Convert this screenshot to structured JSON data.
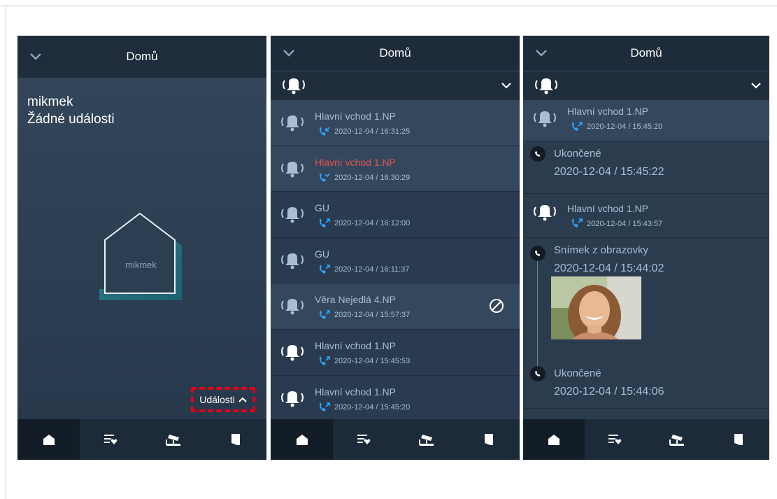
{
  "panels": {
    "home": {
      "title": "Domů",
      "account_name": "mikmek",
      "no_events": "Žádné události",
      "house_label": "mikmek",
      "events_button": "Události"
    },
    "events_list": {
      "title": "Domů",
      "items": [
        {
          "name": "Hlavní vchod 1.NP",
          "time": "2020-12-04 / 16:31:25",
          "call": "incoming",
          "missed": false,
          "blocked": false,
          "highlight": true
        },
        {
          "name": "Hlavní vchod 1.NP",
          "time": "2020-12-04 / 16:30:29",
          "call": "missed",
          "missed": true,
          "blocked": false,
          "highlight": true
        },
        {
          "name": "GU",
          "time": "2020-12-04 / 16:12:00",
          "call": "outgoing",
          "missed": false,
          "blocked": false,
          "highlight": false
        },
        {
          "name": "GU",
          "time": "2020-12-04 / 16:11:37",
          "call": "outgoing",
          "missed": false,
          "blocked": false,
          "highlight": false
        },
        {
          "name": "Věra Nejedlá 4.NP",
          "time": "2020-12-04 / 15:57:37",
          "call": "outgoing",
          "missed": false,
          "blocked": true,
          "highlight": true
        },
        {
          "name": "Hlavní vchod 1.NP",
          "time": "2020-12-04 / 15:45:53",
          "call": "outgoing",
          "missed": false,
          "blocked": false,
          "highlight": false
        },
        {
          "name": "Hlavní vchod 1.NP",
          "time": "2020-12-04 / 15:45:20",
          "call": "outgoing",
          "missed": false,
          "blocked": false,
          "highlight": false
        }
      ]
    },
    "event_detail": {
      "title": "Domů",
      "top_item": {
        "name": "Hlavní vchod 1.NP",
        "time": "2020-12-04 / 15:45:20"
      },
      "ended_1": {
        "label": "Ukončené",
        "time": "2020-12-04 / 15:45:22"
      },
      "second_item": {
        "name": "Hlavní vchod 1.NP",
        "time": "2020-12-04 / 15:43:57"
      },
      "snapshot": {
        "label": "Snímek z obrazovky",
        "time": "2020-12-04 / 15:44:02"
      },
      "ended_2": {
        "label": "Ukončené",
        "time": "2020-12-04 / 15:44:06"
      }
    }
  },
  "nav": {
    "items": [
      "home-icon",
      "list-heart-icon",
      "camera-icon",
      "door-icon"
    ],
    "active": 0
  },
  "colors": {
    "panel_bg": "#2c3c4f",
    "titlebar_bg": "#1e2b3a",
    "text_muted": "#a7bed3",
    "missed": "#e3524e",
    "call_icon": "#29a7ff",
    "highlight_border": "#e1001a",
    "house_accent": "#1c9aa3"
  }
}
